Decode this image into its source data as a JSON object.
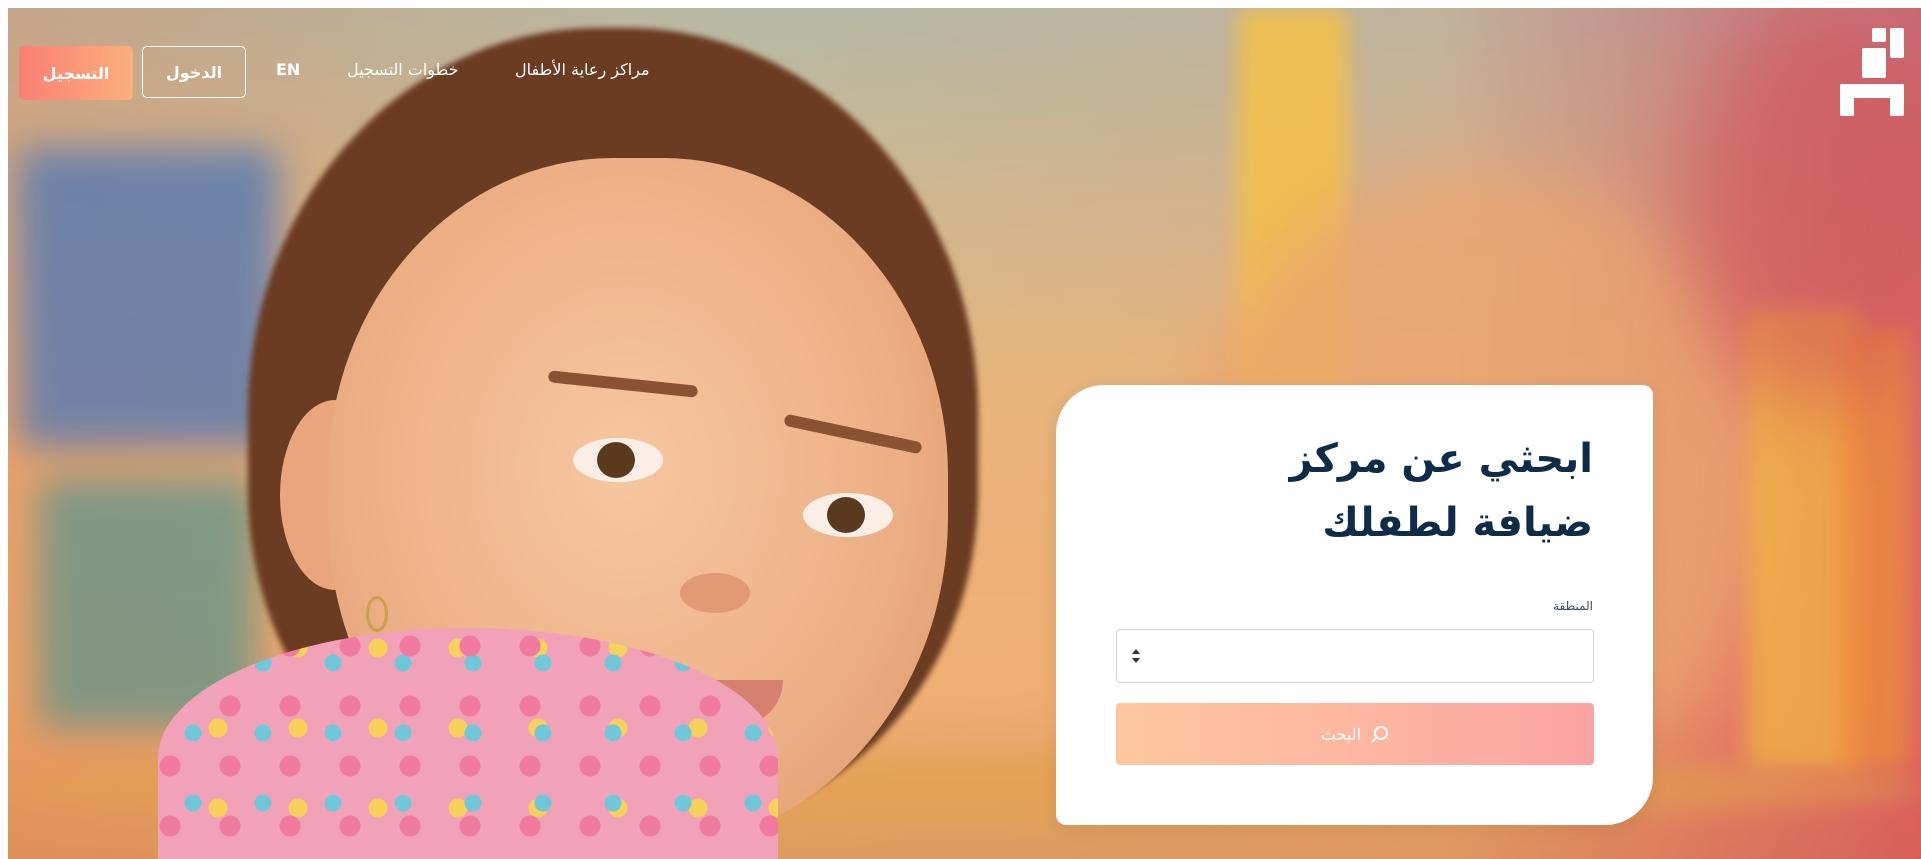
{
  "nav": {
    "childcare_centers": "مراكز رعاية الأطفال",
    "registration_steps": "خطوات التسجيل",
    "language": "EN",
    "login": "الدخول",
    "register": "التسجيل"
  },
  "search_card": {
    "title": "ابحثي عن مركز ضيافة لطفلك",
    "region_label": "المنطقة",
    "region_value": "",
    "search_button": "البحث"
  },
  "icons": {
    "logo": "brand-logo",
    "select_arrows": "sort-arrows-icon",
    "search": "search-icon"
  },
  "colors": {
    "primary_gradient_start": "#fb7f74",
    "primary_gradient_end": "#fbaf7d",
    "title_color": "#0e2b4a"
  }
}
